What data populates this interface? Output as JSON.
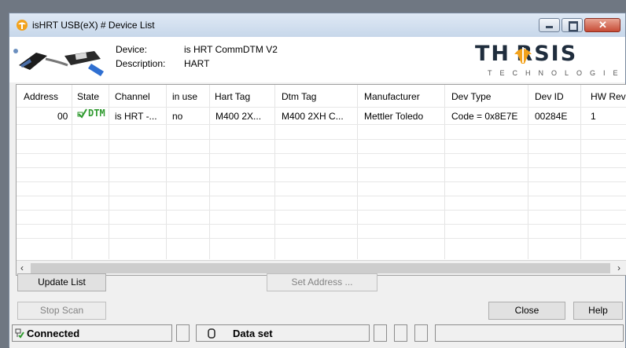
{
  "window": {
    "title": "isHRT USB(eX) # Device List"
  },
  "device_info": {
    "device_label": "Device:",
    "device_value": "is HRT CommDTM V2",
    "description_label": "Description:",
    "description_value": "HART"
  },
  "logo": {
    "word": "TH RSIS",
    "tagline": "TECHNOLOGIES"
  },
  "table": {
    "columns": [
      "Address",
      "State",
      "Channel",
      "in use",
      "Hart Tag",
      "Dtm Tag",
      "Manufacturer",
      "Dev Type",
      "Dev ID",
      "HW Rev"
    ],
    "rows": [
      {
        "address": "00",
        "state": "DTM",
        "channel": "is HRT -...",
        "in_use": "no",
        "hart_tag": "M400 2X...",
        "dtm_tag": "M400 2XH C...",
        "manufacturer": "Mettler Toledo",
        "dev_type": "Code = 0x8E7E",
        "dev_id": "00284E",
        "hw_rev": "1"
      }
    ]
  },
  "buttons": {
    "update_list": "Update List",
    "set_address": "Set Address ...",
    "stop_scan": "Stop Scan",
    "close": "Close",
    "help": "Help"
  },
  "status": {
    "connection": "Connected",
    "data": "Data set"
  },
  "colors": {
    "state_green": "#2e9a2e",
    "logo_orange": "#f2a21c"
  }
}
